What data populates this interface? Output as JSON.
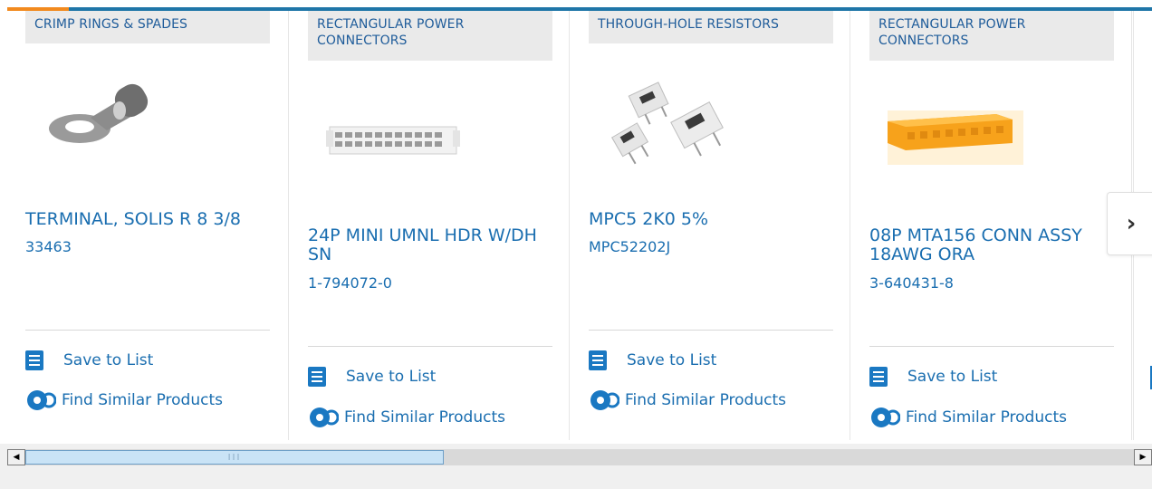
{
  "carousel": {
    "cards": [
      {
        "category": "CRIMP RINGS & SPADES",
        "title": "TERMINAL, SOLIS R 8 3/8",
        "part_number": "33463",
        "save_label": "Save to List",
        "similar_label": "Find Similar Products",
        "image": "ring-terminal"
      },
      {
        "category": "RECTANGULAR POWER CONNECTORS",
        "title": "24P MINI UMNL HDR W/DH SN",
        "part_number": "1-794072-0",
        "save_label": "Save to List",
        "similar_label": "Find Similar Products",
        "image": "white-connector-header"
      },
      {
        "category": "THROUGH-HOLE RESISTORS",
        "title": "MPC5 2K0 5%",
        "part_number": "MPC52202J",
        "save_label": "Save to List",
        "similar_label": "Find Similar Products",
        "image": "power-resistors"
      },
      {
        "category": "RECTANGULAR POWER CONNECTORS",
        "title": "08P MTA156 CONN ASSY 18AWG ORA",
        "part_number": "3-640431-8",
        "save_label": "Save to List",
        "similar_label": "Find Similar Products",
        "image": "orange-connector"
      }
    ],
    "next_icon": "chevron-right-icon",
    "next_glyph": "›"
  },
  "scrollbar": {
    "left_arrow": "◀",
    "right_arrow": "▶",
    "grip": "III"
  },
  "colors": {
    "accent": "#f28a1e",
    "brand_blue": "#1f76a8",
    "link": "#1a6eb0"
  }
}
